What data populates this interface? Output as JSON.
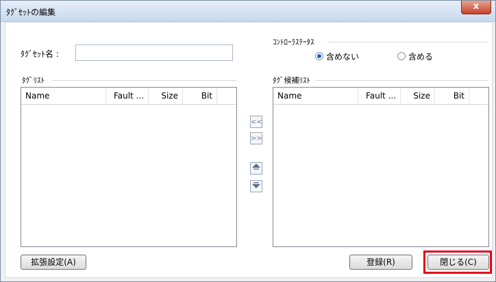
{
  "window": {
    "title": "ﾀｸﾞｾｯﾄの編集",
    "close_symbol": "x"
  },
  "form": {
    "tagset_name_label": "ﾀｸﾞｾｯﾄ名 :",
    "tagset_name_value": ""
  },
  "controller_status": {
    "group_label": "ｺﾝﾄﾛｰﾗｽﾃｰﾀｽ",
    "option_exclude": "含めない",
    "option_include": "含める",
    "selected": "含めない"
  },
  "tag_list": {
    "group_label": "ﾀｸﾞﾘｽﾄ",
    "columns": [
      "Name",
      "Fault ...",
      "Size",
      "Bit"
    ],
    "rows": []
  },
  "candidate_list": {
    "group_label": "ﾀｸﾞ候補ﾘｽﾄ",
    "columns": [
      "Name",
      "Fault ...",
      "Size",
      "Bit"
    ],
    "rows": []
  },
  "middle_buttons": {
    "move_left": "<<",
    "move_right": ">>"
  },
  "footer": {
    "extended_settings": "拡張設定(A)",
    "register": "登録(R)",
    "close": "閉じる(C)"
  },
  "colors": {
    "highlight": "#e2001a",
    "radio_selected": "#1f5fbf"
  }
}
